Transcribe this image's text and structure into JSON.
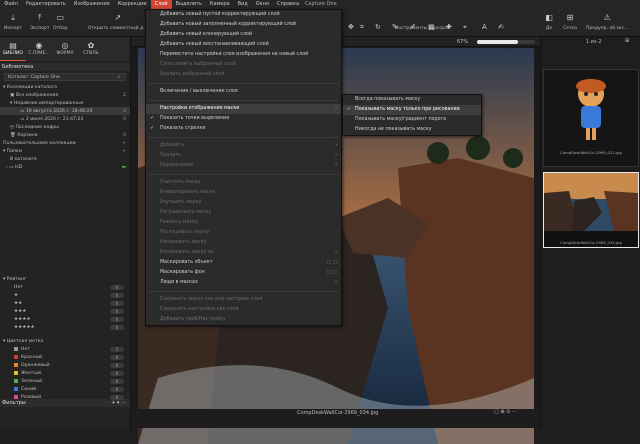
{
  "menubar": {
    "items": [
      "Файл",
      "Редактировать",
      "Изображение",
      "Коррекции",
      "Слой",
      "Выделить",
      "Камера",
      "Вид",
      "Окно",
      "Справка"
    ],
    "active_index": 4,
    "app_title": "Capture One"
  },
  "toolbar": {
    "import": "Импорт",
    "export": "Экспорт",
    "select": "Отбор",
    "open_variant": "Открыть совместный д...",
    "cursor_tools": "Инструменты курсора",
    "before": "До",
    "grid": "Сетка",
    "preview": "Предупр. об экс..."
  },
  "left_panel": {
    "tabs": [
      {
        "label": "БИБЛИО",
        "icon": "library-icon"
      },
      {
        "label": "С.ПРИЕ...",
        "icon": "capture-icon"
      },
      {
        "label": "ФОРМА",
        "icon": "lens-icon"
      },
      {
        "label": "СТИЛЬ",
        "icon": "style-icon"
      }
    ],
    "library_header": "Библиотека",
    "catalog_label": "Каталог: Capture One",
    "catalog_collections": "Коллекции каталога",
    "all_images": "Все изображения",
    "all_images_count": "2",
    "recent_imports": "Недавние импортированные",
    "import_1": "19 августа 2026 г. 18:48:24",
    "import_1_count": "2",
    "import_2": "2 июля 2026 г. 21:47:23",
    "import_2_count": "0",
    "recent_captures": "Последние кадры",
    "trash": "Корзина",
    "trash_count": "0",
    "user_collections": "Пользовательские коллекции",
    "folders": "Папки",
    "in_catalog": "В каталоге",
    "hd": "HD"
  },
  "filters": {
    "header": "Фильтры",
    "ratings_label": "Рейтинг",
    "rating_rows": [
      {
        "label": "Нет",
        "count": "0"
      },
      {
        "label": "★",
        "count": "0"
      },
      {
        "label": "★★",
        "count": "0"
      },
      {
        "label": "★★★",
        "count": "0"
      },
      {
        "label": "★★★★",
        "count": "0"
      },
      {
        "label": "★★★★★",
        "count": "0"
      }
    ],
    "color_label": "Цветная метка",
    "color_rows": [
      {
        "label": "Нет",
        "color": "#9a9a9a",
        "count": "2"
      },
      {
        "label": "Красный",
        "color": "#d33a3a",
        "count": "0"
      },
      {
        "label": "Оранжевый",
        "color": "#e08a2a",
        "count": "0"
      },
      {
        "label": "Желтый",
        "color": "#d8c22a",
        "count": "0"
      },
      {
        "label": "Зеленый",
        "color": "#4caf50",
        "count": "0"
      },
      {
        "label": "Синий",
        "color": "#3a7bd8",
        "count": "0"
      },
      {
        "label": "Розовый",
        "color": "#d84aa0",
        "count": "0"
      }
    ]
  },
  "layer_menu": {
    "items": [
      {
        "label": "Добавить новый пустой корректирующий слой",
        "enabled": true
      },
      {
        "label": "Добавить новый заполненный корректирующий слой",
        "enabled": true
      },
      {
        "label": "Добавить новый клонирующий слой",
        "enabled": true
      },
      {
        "label": "Добавить новый восстанавливающий слой",
        "enabled": true
      },
      {
        "label": "Переместите настройки слоя изображения на новый слой",
        "enabled": true
      },
      {
        "label": "Сопоставить выбранный слой",
        "enabled": false
      },
      {
        "label": "Удалить выбранный слой",
        "enabled": false
      },
      {
        "sep": true
      },
      {
        "label": "Включение / выключение слоя",
        "enabled": true
      },
      {
        "sep": true
      },
      {
        "label": "Настройки отображения маски",
        "enabled": true,
        "highlight": true,
        "submenu": true
      },
      {
        "label": "Показать точки выделения",
        "enabled": true,
        "check": true
      },
      {
        "label": "Показать стрелки",
        "enabled": true,
        "check": true
      },
      {
        "sep": true
      },
      {
        "label": "Добавить",
        "enabled": false,
        "submenu": true
      },
      {
        "label": "Удалить",
        "enabled": false,
        "submenu": true
      },
      {
        "label": "Пересечение",
        "enabled": false,
        "submenu": true
      },
      {
        "sep": true
      },
      {
        "label": "Очистить маску",
        "enabled": false
      },
      {
        "label": "Инвертировать маску",
        "enabled": false
      },
      {
        "label": "Улучшить маску",
        "enabled": false
      },
      {
        "label": "Регулировать маску",
        "enabled": false
      },
      {
        "label": "Размыть маску",
        "enabled": false
      },
      {
        "label": "Растушевать маску",
        "enabled": false
      },
      {
        "label": "Копировать маску",
        "enabled": false
      },
      {
        "label": "Копировать маску из",
        "enabled": false,
        "submenu": true
      },
      {
        "label": "Маскировать объект",
        "enabled": true,
        "shortcut": true
      },
      {
        "label": "Маскировать фон",
        "enabled": true,
        "shortcut": true
      },
      {
        "label": "Люди в масках",
        "enabled": true,
        "submenu": true
      },
      {
        "sep": true
      },
      {
        "label": "Сохранить маску как ряд настроек слоя",
        "enabled": false
      },
      {
        "label": "Сохранить настройки как слой",
        "enabled": false
      },
      {
        "label": "Добавить гриб/Настройку",
        "enabled": false
      }
    ]
  },
  "mask_submenu": {
    "items": [
      {
        "label": "Всегда показывать маску",
        "check": false
      },
      {
        "label": "Показывать маску только при рисовании",
        "check": true,
        "highlight": true
      },
      {
        "label": "Показывать маску/градиент порога",
        "check": false
      },
      {
        "label": "Никогда не показывать маску",
        "check": false
      }
    ]
  },
  "viewer": {
    "zoom": "67%",
    "page": "1 из 2",
    "filename": "CompDeskWallCol-2969_034.jpg"
  },
  "browser": {
    "thumbs": [
      {
        "caption": "CompDeskWallCol-2969_022.jpg"
      },
      {
        "caption": "CompDeskWallCol-2969_034.jpg"
      }
    ]
  },
  "colors": {
    "accent": "#d34432",
    "menu_highlight": "#3e3e3e"
  }
}
